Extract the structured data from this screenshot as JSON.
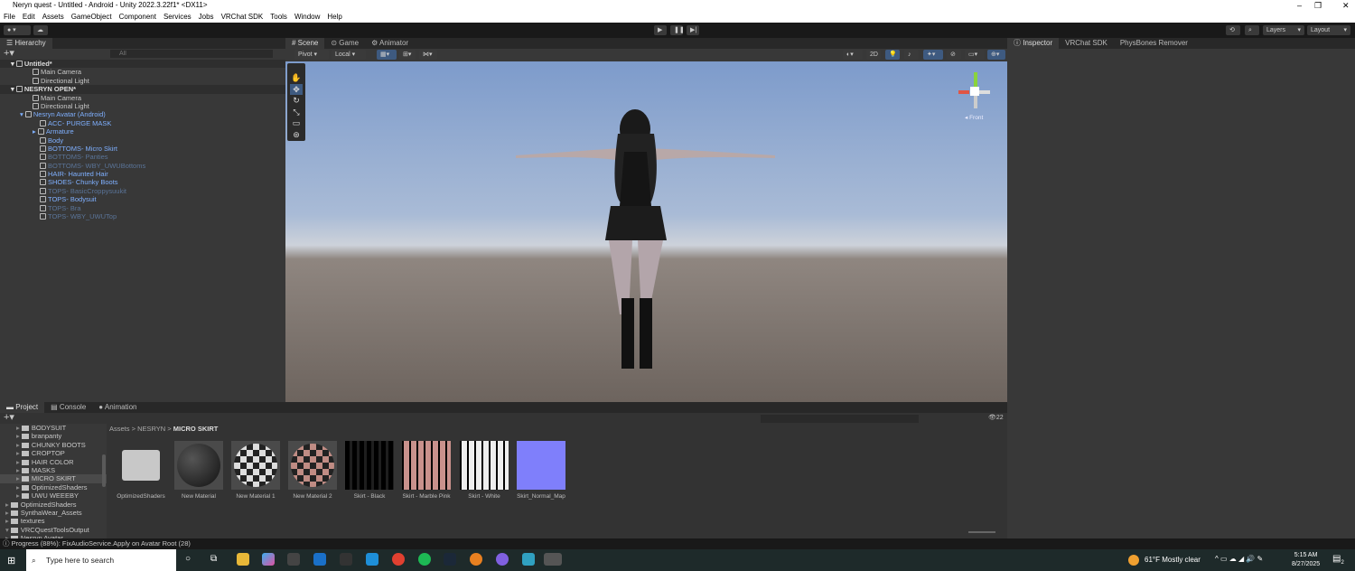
{
  "window": {
    "title": "Neryn quest - Untitled - Android - Unity 2022.3.22f1* <DX11>"
  },
  "menu": [
    "File",
    "Edit",
    "Assets",
    "GameObject",
    "Component",
    "Services",
    "Jobs",
    "VRChat SDK",
    "Tools",
    "Window",
    "Help"
  ],
  "toolbar": {
    "layers": "Layers",
    "layout": "Layout"
  },
  "hierarchy": {
    "tab": "Hierarchy",
    "search_placeholder": "All",
    "items": [
      {
        "label": "Untitled*",
        "type": "scene"
      },
      {
        "label": "Main Camera",
        "type": "obj"
      },
      {
        "label": "Directional Light",
        "type": "obj"
      },
      {
        "label": "NESRYN OPEN*",
        "type": "scene"
      },
      {
        "label": "Main Camera",
        "type": "obj"
      },
      {
        "label": "Directional Light",
        "type": "obj"
      },
      {
        "label": "Nesryn Avatar (Android)",
        "type": "prefab"
      },
      {
        "label": "ACC- PURGE MASK",
        "type": "child"
      },
      {
        "label": "Armature",
        "type": "child"
      },
      {
        "label": "Body",
        "type": "child"
      },
      {
        "label": "BOTTOMS- Micro Skirt",
        "type": "child"
      },
      {
        "label": "BOTTOMS- Panties",
        "type": "disabled"
      },
      {
        "label": "BOTTOMS- WBY_UWUBottoms",
        "type": "disabled"
      },
      {
        "label": "HAIR- Haunted Hair",
        "type": "child"
      },
      {
        "label": "SHOES- Chunky Boots",
        "type": "child"
      },
      {
        "label": "TOPS- BasicCroppysuukit",
        "type": "disabled"
      },
      {
        "label": "TOPS- Bodysuit",
        "type": "child"
      },
      {
        "label": "TOPS- Bra",
        "type": "disabled"
      },
      {
        "label": "TOPS- WBY_UWUTop",
        "type": "disabled"
      }
    ]
  },
  "scene": {
    "tabs": [
      "Scene",
      "Game",
      "Animator"
    ],
    "pivot": "Pivot",
    "local": "Local",
    "mode_2d": "2D",
    "gizmo_label": "Front"
  },
  "inspector": {
    "tabs": [
      "Inspector",
      "VRChat SDK",
      "PhysBones Remover"
    ]
  },
  "project": {
    "tabs": [
      "Project",
      "Console",
      "Animation"
    ],
    "folders": [
      "BODYSUIT",
      "branpanty",
      "CHUNKY BOOTS",
      "CROPTOP",
      "HAIR COLOR",
      "MASKS",
      "MICRO SKIRT",
      "OptimizedShaders",
      "UWU WEEEBY",
      "OptimizedShaders",
      "SynthaWear_Assets",
      "textures",
      "VRCQuestToolsOutput",
      "Nesryn Avatar"
    ],
    "breadcrumb": [
      "Assets",
      "NESRYN",
      "MICRO SKIRT"
    ],
    "count": "22",
    "assets": [
      "OptimizedShaders",
      "New Material",
      "New Material 1",
      "New Material 2",
      "Skirt - Black",
      "Skirt - Marble Pink",
      "Skirt - White",
      "Skirt_Normal_Map"
    ]
  },
  "status": "Progress (88%): FixAudioService.Apply on Avatar Root (28)",
  "progress_percent": 88,
  "taskbar": {
    "search_placeholder": "Type here to search",
    "weather": "61°F  Mostly clear",
    "time": "5:15 AM",
    "date": "8/27/2025",
    "notifications": "2"
  }
}
